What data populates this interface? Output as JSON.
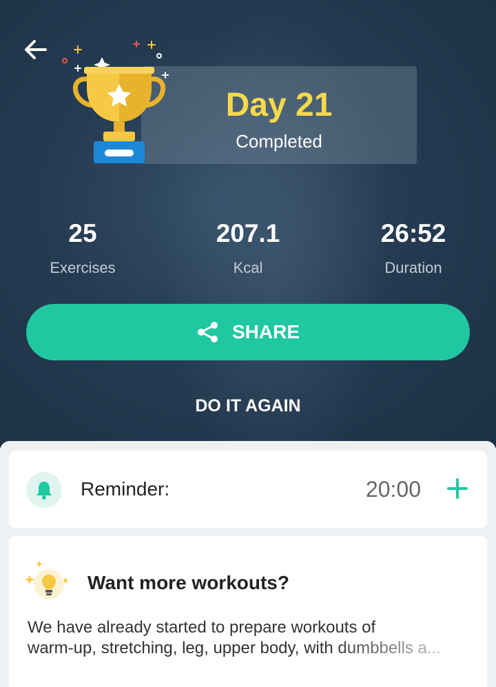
{
  "header": {
    "day_title": "Day 21",
    "day_status": "Completed"
  },
  "stats": [
    {
      "value": "25",
      "label": "Exercises"
    },
    {
      "value": "207.1",
      "label": "Kcal"
    },
    {
      "value": "26:52",
      "label": "Duration"
    }
  ],
  "actions": {
    "share_label": "SHARE",
    "again_label": "DO IT AGAIN"
  },
  "reminder": {
    "label": "Reminder:",
    "time": "20:00"
  },
  "more": {
    "title": "Want more workouts?",
    "line1": "We have already started to prepare workouts of",
    "line2": "warm-up, stretching, leg, upper body, with dumbbells a..."
  },
  "icons": {
    "back": "arrow-left-icon",
    "trophy": "trophy-icon",
    "share": "share-icon",
    "bell": "bell-icon",
    "add": "plus-icon",
    "bulb": "lightbulb-icon"
  },
  "colors": {
    "accent": "#1fc8a0",
    "title_yellow": "#f6d94a",
    "hero_bg": "#253b51"
  }
}
